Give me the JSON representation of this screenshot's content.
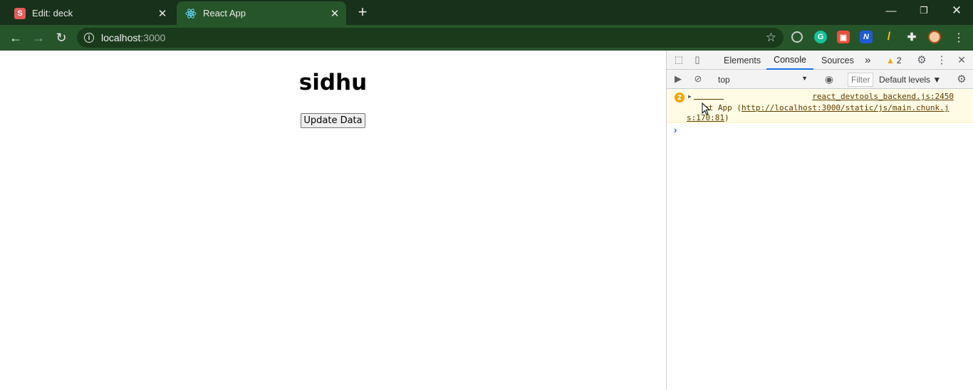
{
  "browser": {
    "tabs": [
      {
        "title": "Edit: deck",
        "favicon": "S",
        "active": false
      },
      {
        "title": "React App",
        "favicon": "react-icon",
        "active": true
      }
    ],
    "new_tab": "+",
    "window_controls": [
      "minimize-icon",
      "restore-icon",
      "close-icon"
    ],
    "url": {
      "host": "localhost",
      "port": ":3000"
    },
    "extensions": [
      "circle-extension-icon",
      "grammarly-icon",
      "extension-red-icon",
      "extension-n-icon",
      "pencil-icon",
      "puzzle-icon",
      "profile-avatar"
    ]
  },
  "page": {
    "heading": "sidhu",
    "button_label": "Update Data"
  },
  "devtools": {
    "tabs": [
      "Elements",
      "Console",
      "Sources"
    ],
    "active_tab": "Console",
    "more": "»",
    "warning_count": "2",
    "context": "top",
    "filter_placeholder": "Filter",
    "levels": "Default levels ▼",
    "message": {
      "count": "2",
      "source": "react_devtools_backend.js:2450",
      "line2_prefix": "at App (",
      "link_a": "http://localhost:3000/static/js/main.chunk.j",
      "link_b": "s:170:81",
      "line3_suffix": ")"
    },
    "prompt": "›"
  },
  "colors": {
    "tabstrip": "#18311a",
    "toolbar": "#27552a",
    "warning_bg": "#fffbe5",
    "warning_badge": "#f2a600",
    "console_accent": "#1a73e8"
  }
}
